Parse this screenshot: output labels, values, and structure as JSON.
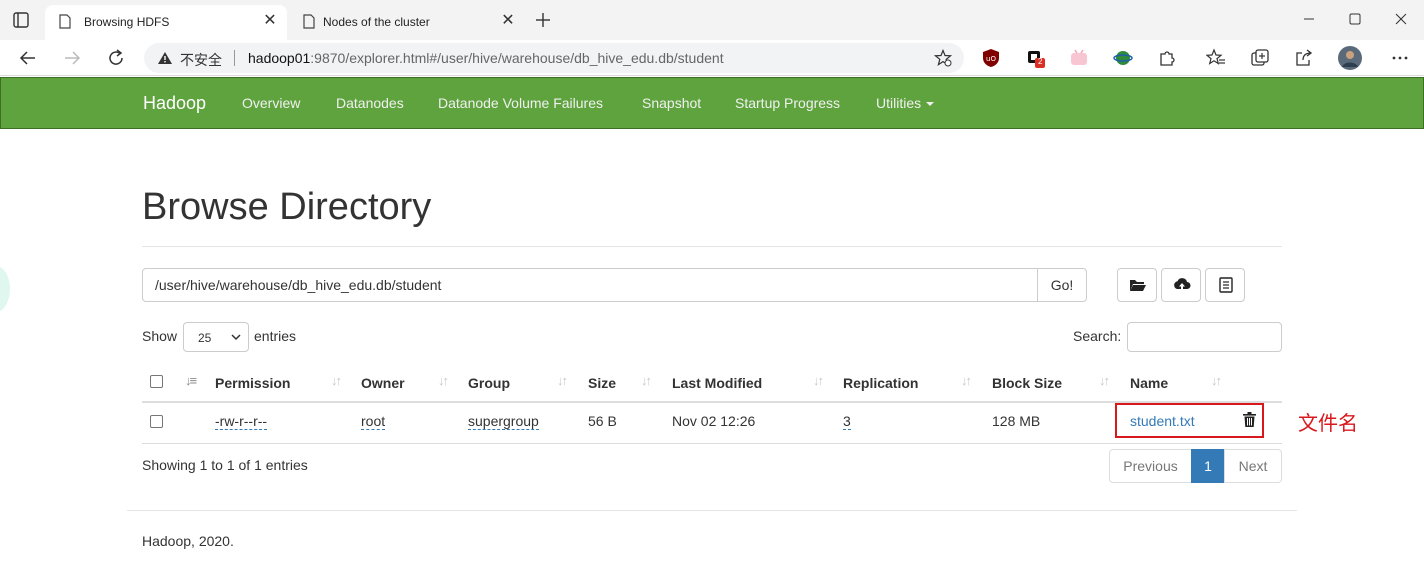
{
  "browser": {
    "tabs": [
      {
        "title": "Browsing HDFS",
        "active": true
      },
      {
        "title": "Nodes of the cluster",
        "active": false
      }
    ],
    "address": {
      "insecure_label": "不安全",
      "host": "hadoop01",
      "rest": ":9870/explorer.html#/user/hive/warehouse/db_hive_edu.db/student"
    },
    "extension_badge": "2"
  },
  "navbar": {
    "brand": "Hadoop",
    "items": [
      "Overview",
      "Datanodes",
      "Datanode Volume Failures",
      "Snapshot",
      "Startup Progress",
      "Utilities"
    ]
  },
  "page": {
    "title": "Browse Directory",
    "path_value": "/user/hive/warehouse/db_hive_edu.db/student",
    "go_label": "Go!",
    "show_label": "Show",
    "page_length": "25",
    "entries_label": "entries",
    "search_label": "Search:",
    "search_value": ""
  },
  "table": {
    "headers": [
      "Permission",
      "Owner",
      "Group",
      "Size",
      "Last Modified",
      "Replication",
      "Block Size",
      "Name"
    ],
    "rows": [
      {
        "permission": "-rw-r--r--",
        "owner": "root",
        "group": "supergroup",
        "size": "56 B",
        "last_modified": "Nov 02 12:26",
        "replication": "3",
        "block_size": "128 MB",
        "name": "student.txt"
      }
    ],
    "info": "Showing 1 to 1 of 1 entries",
    "pagination": {
      "prev": "Previous",
      "current": "1",
      "next": "Next"
    }
  },
  "annotation": "文件名",
  "footer": "Hadoop, 2020.",
  "colors": {
    "navbar": "#5fa33e",
    "link": "#337ab7",
    "annotation": "#d9181e"
  }
}
